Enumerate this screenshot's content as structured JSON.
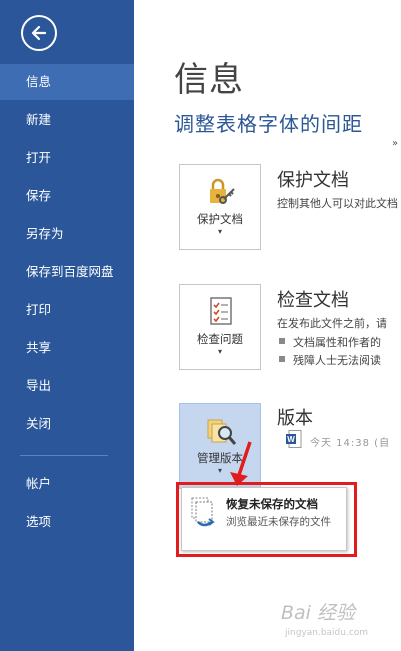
{
  "sidebar": {
    "items": [
      {
        "label": "信息"
      },
      {
        "label": "新建"
      },
      {
        "label": "打开"
      },
      {
        "label": "保存"
      },
      {
        "label": "另存为"
      },
      {
        "label": "保存到百度网盘"
      },
      {
        "label": "打印"
      },
      {
        "label": "共享"
      },
      {
        "label": "导出"
      },
      {
        "label": "关闭"
      },
      {
        "label": "帐户"
      },
      {
        "label": "选项"
      }
    ],
    "active_item": "信息"
  },
  "main": {
    "title": "信息",
    "document_title": "调整表格字体的间距",
    "scroll_hint": "»",
    "sections": [
      {
        "button_label": "保护文档",
        "caret": "▾",
        "heading": "保护文档",
        "description": "控制其他人可以对此文档"
      },
      {
        "button_label": "检查问题",
        "caret": "▾",
        "heading": "检查文档",
        "description": "在发布此文件之前，请",
        "bullets": [
          "文档属性和作者的",
          "残障人士无法阅读"
        ]
      },
      {
        "button_label": "管理版本",
        "caret": "▾",
        "heading": "版本",
        "version_entry": "今天 14:38 (自"
      }
    ],
    "dropdown": {
      "title": "恢复未保存的文档",
      "description": "浏览最近未保存的文件"
    }
  },
  "watermark": {
    "logo": "Bai 经验",
    "sub": "jingyan.baidu.com"
  },
  "colors": {
    "sidebar_bg": "#2b579a",
    "sidebar_active": "#3e6db3",
    "doc_title": "#2b5797",
    "highlight": "#e21c1c",
    "pressed_btn": "#c5d7ef"
  }
}
